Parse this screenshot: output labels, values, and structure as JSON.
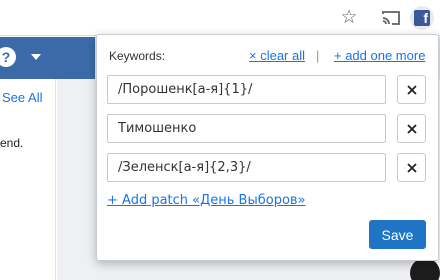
{
  "page": {
    "see_all": "See All",
    "body_fragment": "end.",
    "help_glyph": "?"
  },
  "toolbar": {
    "bookmark_icon": "star-icon",
    "cast_icon": "cast-icon",
    "extension_icon": "facebook-extension-icon",
    "extension_glyph": "f"
  },
  "popup": {
    "keywords_label": "Keywords:",
    "clear_all": "× clear all",
    "separator": "|",
    "add_one_more": "+ add one more",
    "keywords": [
      "/Порошенк[а-я]{1}/",
      "Тимошенко",
      "/Зеленск[а-я]{2,3}/"
    ],
    "add_patch": "+ Add patch «День Выборов»",
    "save_label": "Save"
  },
  "colors": {
    "accent": "#1f74c6",
    "link": "#1a73e8",
    "header_blue": "#3c6aa9",
    "facebook": "#3b5998"
  }
}
